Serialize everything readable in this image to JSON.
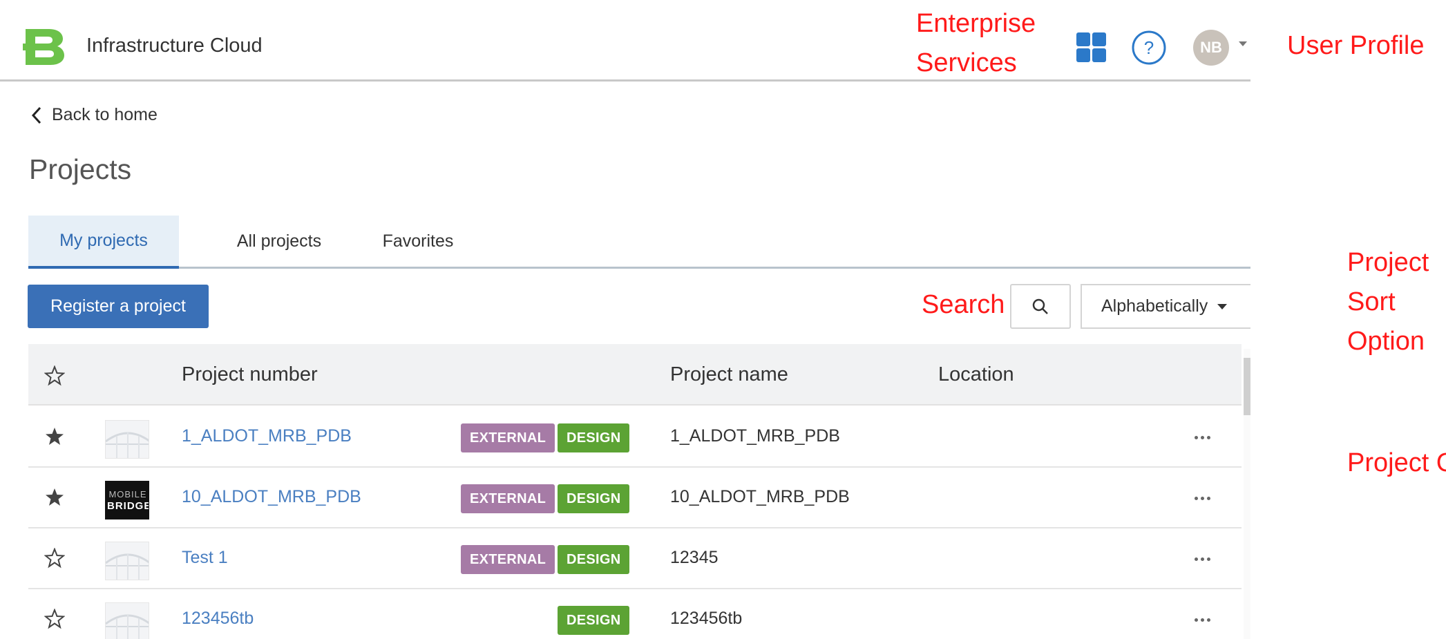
{
  "header": {
    "app_title": "Infrastructure Cloud",
    "avatar_initials": "NB",
    "brand_color": "#6cc24a",
    "apps_icon": "grid-apps-icon",
    "help_icon": "help-icon",
    "help_symbol": "?"
  },
  "annotations": {
    "enterprise_services": "Enterprise Services",
    "user_profile": "User Profile",
    "search": "Search",
    "project_sort_option": "Project Sort Option",
    "project_options": "Project Options",
    "color": "#ff1a1a"
  },
  "nav": {
    "back_label": "Back to home"
  },
  "page": {
    "title": "Projects"
  },
  "tabs": [
    {
      "label": "My projects",
      "active": true
    },
    {
      "label": "All projects",
      "active": false
    },
    {
      "label": "Favorites",
      "active": false
    }
  ],
  "toolbar": {
    "register_label": "Register a project",
    "search_icon": "search-icon",
    "sort_value": "Alphabetically"
  },
  "table": {
    "columns": [
      "Project number",
      "Project name",
      "Location"
    ],
    "rows": [
      {
        "favorite": true,
        "thumbnail": "bridge-photo",
        "number": "1_ALDOT_MRB_PDB",
        "badges": [
          "EXTERNAL",
          "DESIGN"
        ],
        "name": "1_ALDOT_MRB_PDB",
        "location": ""
      },
      {
        "favorite": true,
        "thumbnail": "mobile-bridge-logo",
        "thumbnail_text": [
          "MOBILE",
          "BRIDGE"
        ],
        "number": "10_ALDOT_MRB_PDB",
        "badges": [
          "EXTERNAL",
          "DESIGN"
        ],
        "name": "10_ALDOT_MRB_PDB",
        "location": ""
      },
      {
        "favorite": false,
        "thumbnail": "bridge-photo",
        "number": "Test 1",
        "badges": [
          "EXTERNAL",
          "DESIGN"
        ],
        "name": "12345",
        "location": ""
      },
      {
        "favorite": false,
        "thumbnail": "bridge-photo",
        "number": "123456tb",
        "badges": [
          "DESIGN"
        ],
        "name": "123456tb",
        "location": ""
      }
    ]
  },
  "colors": {
    "primary_button": "#3a70b7",
    "link": "#4a7fc1",
    "badge_external": "#a67ba6",
    "badge_design": "#5ca334",
    "tab_active_bg": "#e6eff7"
  }
}
